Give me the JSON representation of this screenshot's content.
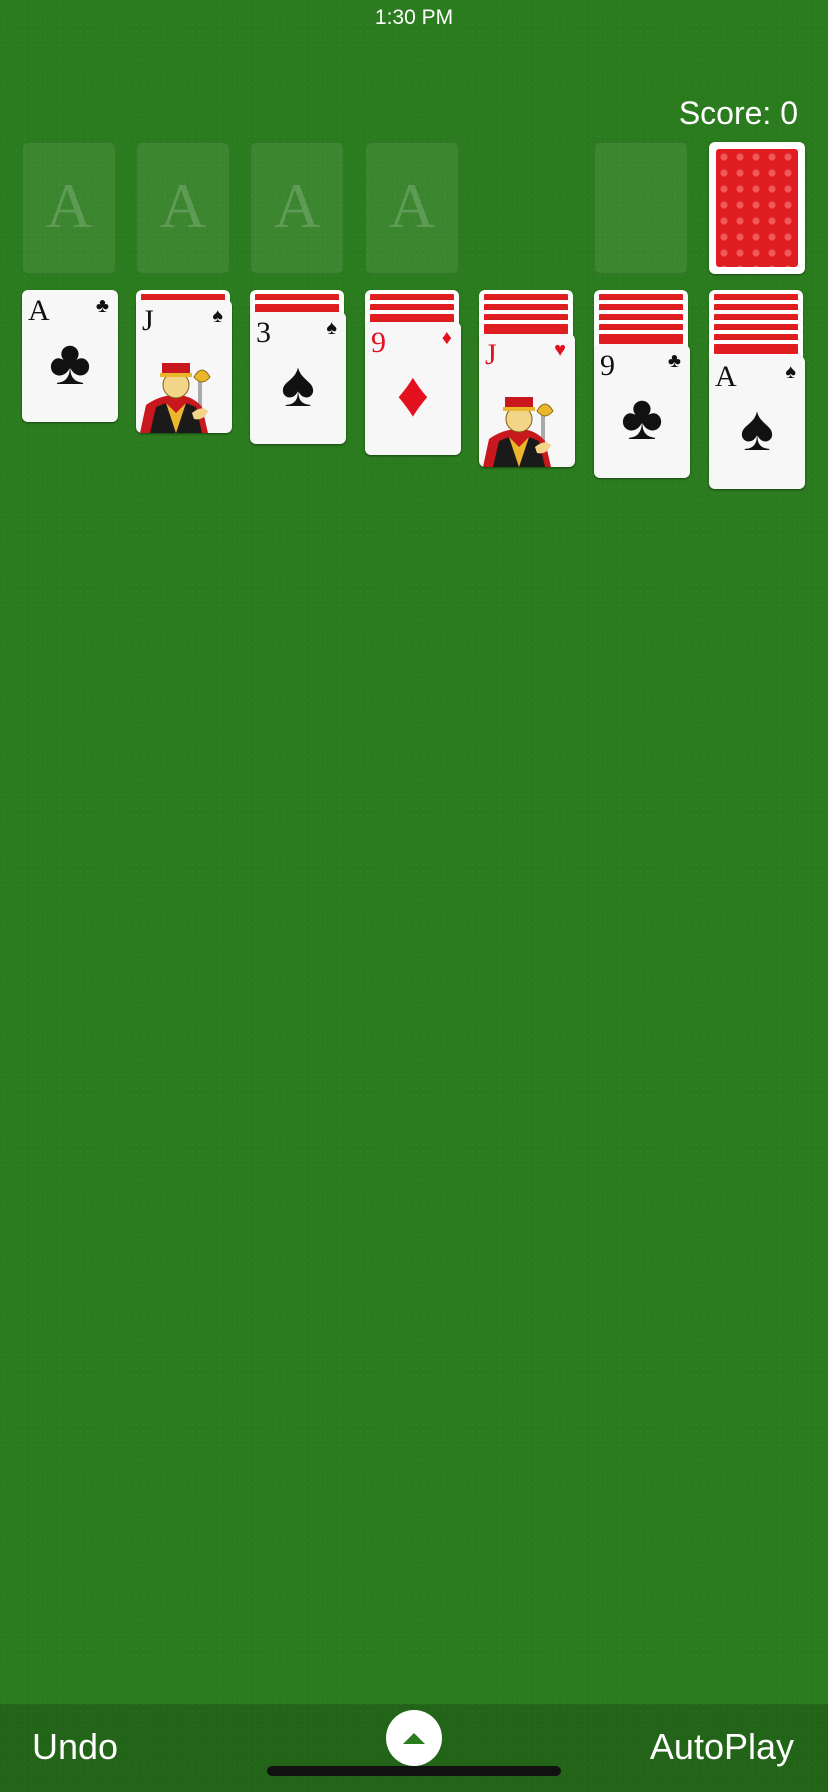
{
  "status_bar": {
    "time": "1:30 PM"
  },
  "score_text": "Score: 0",
  "foundations": [
    {
      "placeholder": "A"
    },
    {
      "placeholder": "A"
    },
    {
      "placeholder": "A"
    },
    {
      "placeholder": "A"
    }
  ],
  "stock": {
    "face": "down"
  },
  "tableau": [
    {
      "face_down_count": 0,
      "top_card": {
        "rank": "A",
        "suit_symbol": "♣",
        "color": "black"
      }
    },
    {
      "face_down_count": 1,
      "top_card": {
        "rank": "J",
        "suit_symbol": "♠",
        "color": "black"
      }
    },
    {
      "face_down_count": 2,
      "top_card": {
        "rank": "3",
        "suit_symbol": "♠",
        "color": "black"
      }
    },
    {
      "face_down_count": 3,
      "top_card": {
        "rank": "9",
        "suit_symbol": "♦",
        "color": "red"
      }
    },
    {
      "face_down_count": 4,
      "top_card": {
        "rank": "J",
        "suit_symbol": "♥",
        "color": "red"
      }
    },
    {
      "face_down_count": 5,
      "top_card": {
        "rank": "9",
        "suit_symbol": "♣",
        "color": "black"
      }
    },
    {
      "face_down_count": 6,
      "top_card": {
        "rank": "A",
        "suit_symbol": "♠",
        "color": "black"
      }
    }
  ],
  "bottom_bar": {
    "undo_label": "Undo",
    "autoplay_label": "AutoPlay",
    "menu_icon": "chevron-up-icon"
  },
  "colors": {
    "felt": "#2b7c1e",
    "card_back": "#e01e22",
    "red_suit": "#e3101d"
  }
}
